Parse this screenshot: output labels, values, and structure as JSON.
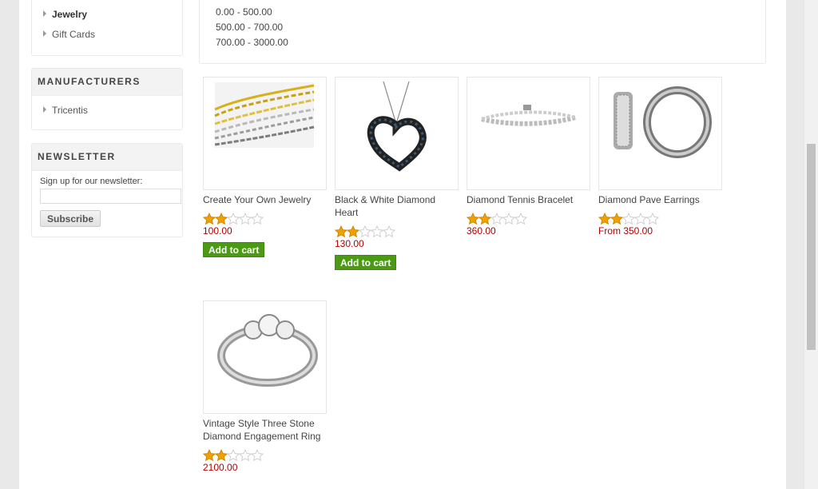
{
  "categories": {
    "items": [
      {
        "label": "Jewelry",
        "active": true
      },
      {
        "label": "Gift Cards",
        "active": false
      }
    ]
  },
  "manufacturers": {
    "title": "MANUFACTURERS",
    "items": [
      {
        "label": "Tricentis"
      }
    ]
  },
  "newsletter": {
    "title": "NEWSLETTER",
    "label": "Sign up for our newsletter:",
    "input_value": "",
    "subscribe_label": "Subscribe"
  },
  "price_ranges": [
    "0.00 - 500.00",
    "500.00 - 700.00",
    "700.00 - 3000.00"
  ],
  "products": [
    {
      "title": "Create Your Own Jewelry",
      "rating": 2,
      "price": "100.00",
      "add_to_cart": "Add to cart",
      "image": "gold-silver-chains"
    },
    {
      "title": "Black & White Diamond Heart",
      "rating": 2,
      "price": "130.00",
      "add_to_cart": "Add to cart",
      "image": "heart-pendant"
    },
    {
      "title": "Diamond Tennis Bracelet",
      "rating": 2,
      "price": "360.00",
      "image": "tennis-bracelet"
    },
    {
      "title": "Diamond Pave Earrings",
      "rating": 2,
      "price": "From 350.00",
      "image": "hoop-earrings"
    },
    {
      "title": "Vintage Style Three Stone Diamond Engagement Ring",
      "rating": 2,
      "price": "2100.00",
      "image": "engagement-ring"
    }
  ],
  "colors": {
    "price": "#b10000",
    "cart_button": "#4a9b13",
    "star_on": "#f0a000",
    "star_off": "#dddddd"
  }
}
